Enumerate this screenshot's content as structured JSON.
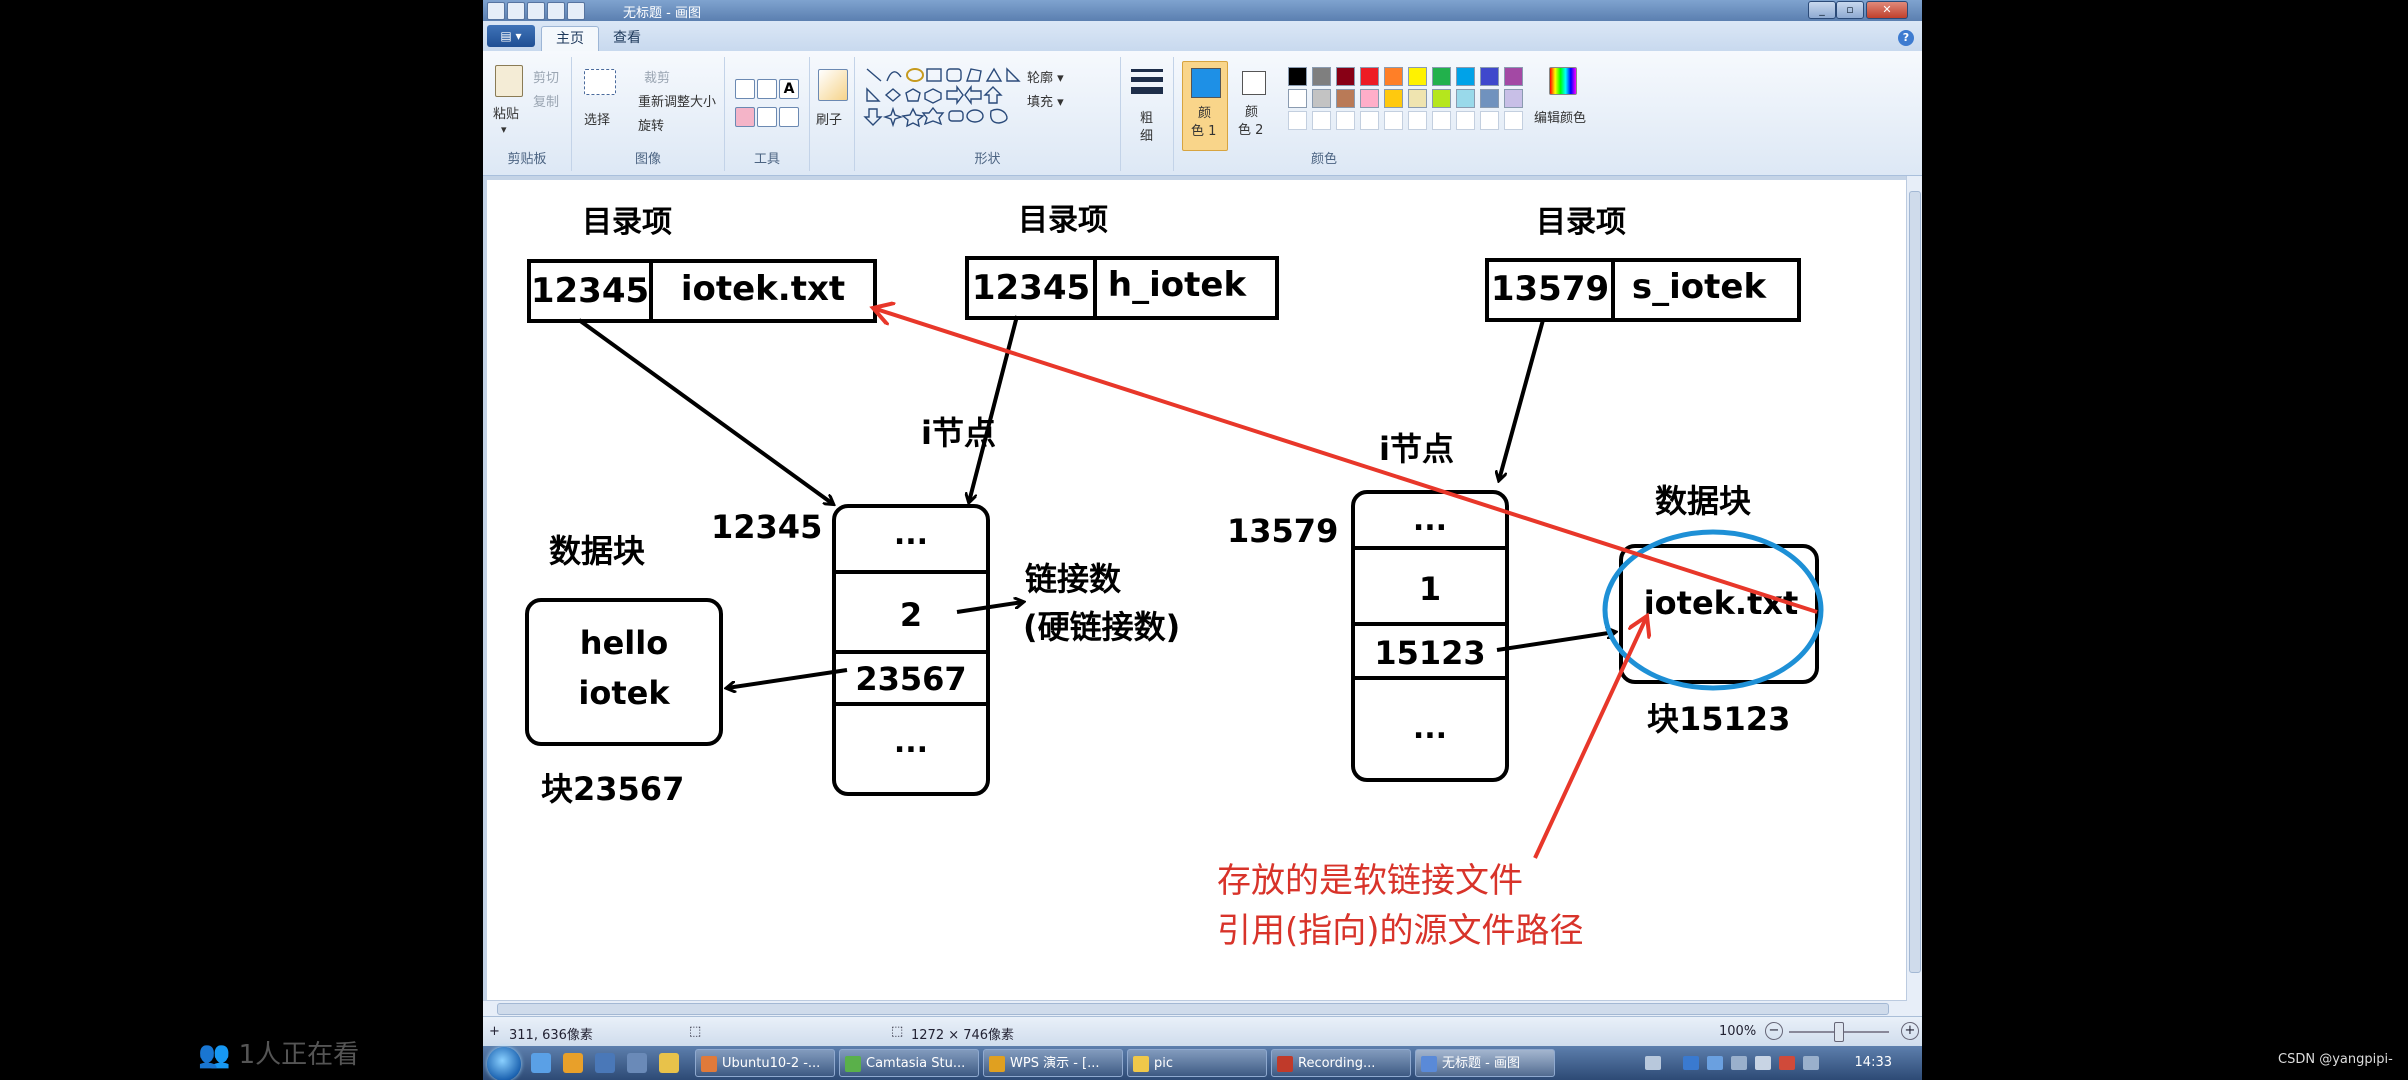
{
  "window": {
    "title": "无标题 - 画图"
  },
  "ribbon_tabs": [
    "主页",
    "查看"
  ],
  "clipboard": {
    "paste": "粘贴",
    "cut": "剪切",
    "copy": "复制",
    "label": "剪贴板"
  },
  "image": {
    "select": "选择",
    "crop": "裁剪",
    "resize": "重新调整大小",
    "rotate": "旋转",
    "label": "图像"
  },
  "tools": {
    "label": "工具"
  },
  "brushes": {
    "label": "刷子"
  },
  "shapes": {
    "outline": "轮廓",
    "fill": "填充",
    "label": "形状"
  },
  "size": {
    "label1": "粗",
    "label2": "细"
  },
  "colors": {
    "color1_a": "颜",
    "color1_b": "色 1",
    "color2_a": "颜",
    "color2_b": "色 2",
    "edit": "编辑颜色",
    "label": "颜色",
    "color1_value": "#1e90e6",
    "color2_value": "#ffffff",
    "palette_row1": [
      "#000000",
      "#7f7f7f",
      "#880015",
      "#ed1c24",
      "#ff7f27",
      "#fff200",
      "#22b14c",
      "#00a2e8",
      "#3f48cc",
      "#a349a4"
    ],
    "palette_row2": [
      "#ffffff",
      "#c3c3c3",
      "#b97a57",
      "#ffaec9",
      "#ffc90e",
      "#efe4b0",
      "#b5e61d",
      "#99d9ea",
      "#7092be",
      "#c8bfe7"
    ]
  },
  "diagram": {
    "dir_label_1": "目录项",
    "dir_label_2": "目录项",
    "dir_label_3": "目录项",
    "entry1": {
      "inode": "12345",
      "name": "iotek.txt"
    },
    "entry2": {
      "inode": "12345",
      "name": "h_iotek"
    },
    "entry3": {
      "inode": "13579",
      "name": "s_iotek"
    },
    "inode_label_1": "i节点",
    "inode_label_2": "i节点",
    "inode1_num": "12345",
    "inode2_num": "13579",
    "inode1_cells": [
      "...",
      "2",
      "23567",
      "..."
    ],
    "inode2_cells": [
      "...",
      "1",
      "15123",
      "..."
    ],
    "link_count_1": "链接数",
    "link_count_2": "(硬链接数)",
    "block_label_1": "数据块",
    "block1_line1": "hello",
    "block1_line2": "iotek",
    "block1_name": "块23567",
    "block_label_2": "数据块",
    "block2_content": "iotek.txt",
    "block2_name": "块15123",
    "note_line1": "存放的是软链接文件",
    "note_line2": "引用(指向)的源文件路径"
  },
  "status": {
    "cursor": "311, 636像素",
    "size": "1272 × 746像素",
    "zoom": "100%"
  },
  "taskbar": {
    "items": [
      "Ubuntu10-2 -...",
      "Camtasia Stu...",
      "WPS 演示 - [...",
      "pic",
      "Recording...",
      "无标题 - 画图"
    ],
    "time": "14:33"
  },
  "overlay": {
    "viewers": "1人正在看",
    "watermark": "CSDN @yangpipi-"
  }
}
